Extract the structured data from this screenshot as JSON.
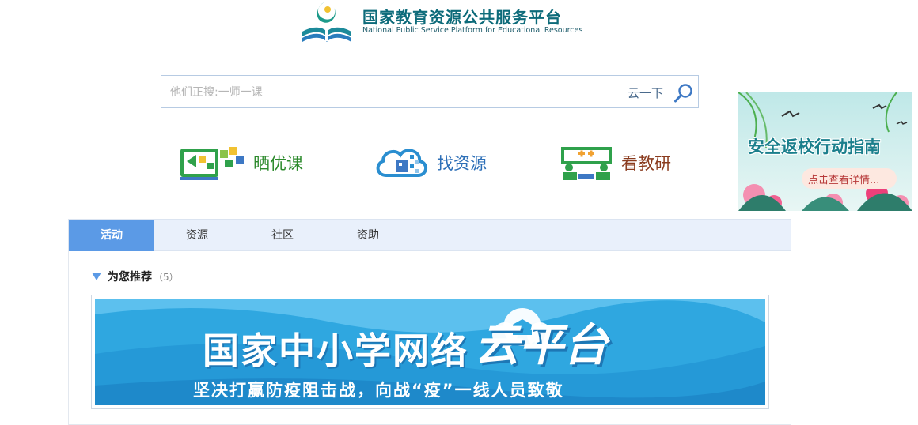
{
  "header": {
    "title_cn": "国家教育资源公共服务平台",
    "title_en": "National Public Service Platform for Educational Resources"
  },
  "search": {
    "placeholder": "他们正搜:一师一课",
    "button_label": "云一下",
    "icon": "search-icon"
  },
  "quick_nav": [
    {
      "label": "晒优课",
      "icon": "showcase-class-icon",
      "color": "#2c8a2c"
    },
    {
      "label": "找资源",
      "icon": "cloud-resource-icon",
      "color": "#2d6fb7"
    },
    {
      "label": "看教研",
      "icon": "teaching-research-icon",
      "color": "#8a3b1e"
    }
  ],
  "ad": {
    "title": "安全返校行动指南",
    "subtitle": "点击查看详情..."
  },
  "tabs": [
    {
      "label": "活动",
      "active": true
    },
    {
      "label": "资源",
      "active": false
    },
    {
      "label": "社区",
      "active": false
    },
    {
      "label": "资助",
      "active": false
    }
  ],
  "recommend": {
    "title": "为您推荐",
    "count": "（5）"
  },
  "banner": {
    "title": "国家中小学网络",
    "cloud_text": "云平台",
    "subtitle": "坚决打赢防疫阻击战，向战“疫”一线人员致敬"
  },
  "colors": {
    "accent": "#5b9ae6",
    "tab_bar": "#e9f0fb",
    "banner_bg": "#2fa7e0",
    "logo": "#0d6b7a"
  }
}
